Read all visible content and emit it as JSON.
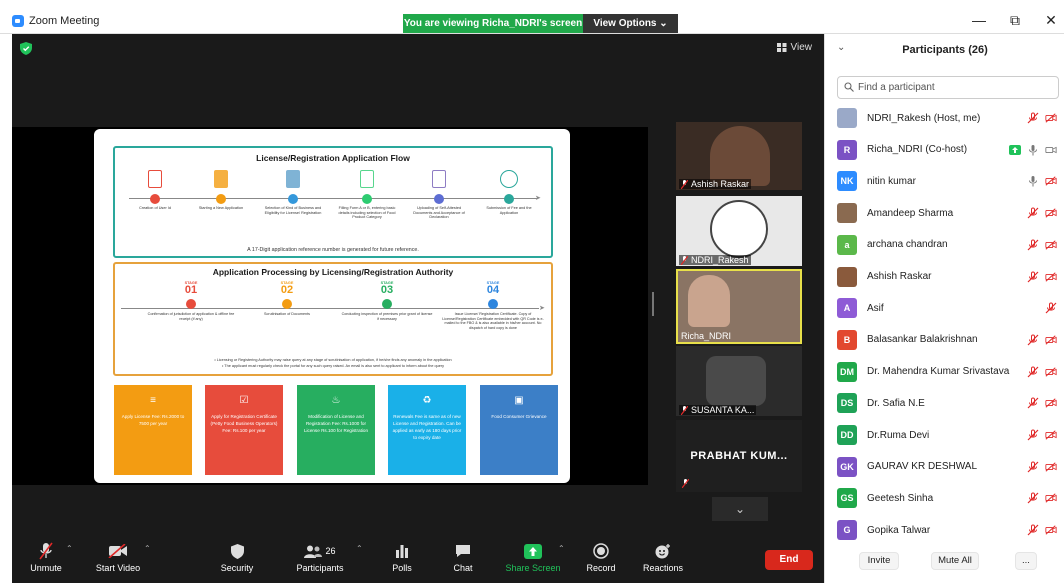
{
  "window": {
    "title": "Zoom Meeting",
    "viewing_banner": "You are viewing Richa_NDRI's screen",
    "view_options": "View Options ⌄",
    "minimize": "—",
    "restore": "⧉",
    "close": "✕"
  },
  "stage": {
    "view_label": "View"
  },
  "slide": {
    "flow_title": "License/Registration Application Flow",
    "flow_steps": [
      "Creation of User Id",
      "Starting a New Application",
      "Selection of Kind of Business and Eligibility for License/ Registration",
      "Filling Form A or B, entering basic details including selection of Food Product Category",
      "Uploading of Self-Attested Documents and Acceptance of Declaration",
      "Submission of Fee and the Application"
    ],
    "flow_note": "A 17-Digit application reference number is generated for future reference.",
    "proc_title": "Application Processing by Licensing/Registration Authority",
    "stage_word": "STAGE",
    "stages": [
      {
        "num": "01",
        "text": "Confirmation of jurisdiction of application & offline fee receipt (if any)"
      },
      {
        "num": "02",
        "text": "Scrutinisation of Documents"
      },
      {
        "num": "03",
        "text": "Conducting inspection of premises prior grant of license if necessary"
      },
      {
        "num": "04",
        "text": "Issue License/ Registration Certificate. Copy of License/Registration Certificate embedded with QR Code is e-mailed to the FBO & is also available in his/her account. No dispatch of hard copy is done"
      }
    ],
    "proc_notes": [
      "• Licensing or Registering Authority may raise query at any stage of scrutinisation of application, if he/she finds any anomaly in the application",
      "• The applicant must regularly check the portal for any such query raised. An email is also sent to applicant to inform about the query"
    ],
    "cards": [
      {
        "text": "Apply License Fee: Rs.2000 to 7500 per year",
        "color": "#f39c12",
        "icon": "≡"
      },
      {
        "text": "Apply for Registration Certificate (Petty Food Business Operators) Fee: Rs.100 per year",
        "color": "#e74c3c",
        "icon": "☑"
      },
      {
        "text": "Modification of License and Registration Fee: Rs.1000 for License Rs.100 for Registration",
        "color": "#27ae60",
        "icon": "♨"
      },
      {
        "text": "Renewals Fee is same as of new License and Registration. Can be applied as early as 180 days prior to expiry date",
        "color": "#1ab0e8",
        "icon": "♻"
      },
      {
        "text": "Food Consumer Grievance",
        "color": "#3c7fc7",
        "icon": "▣"
      }
    ]
  },
  "thumbnails": [
    {
      "name": "Ashish Raskar"
    },
    {
      "name": "NDRI_Rakesh"
    },
    {
      "name": "Richa_NDRI"
    },
    {
      "name": "SUSANTA KA..."
    },
    {
      "name": "PRABHAT KUM..."
    }
  ],
  "toolbar": {
    "unmute": "Unmute",
    "start_video": "Start Video",
    "security": "Security",
    "participants": "Participants",
    "participants_count": "26",
    "polls": "Polls",
    "chat": "Chat",
    "share_screen": "Share Screen",
    "record": "Record",
    "reactions": "Reactions",
    "end": "End"
  },
  "panel": {
    "title": "Participants (26)",
    "search_placeholder": "Find a participant",
    "invite": "Invite",
    "mute_all": "Mute All",
    "more": "...",
    "participants": [
      {
        "name": "NDRI_Rakesh (Host, me)",
        "initials": "",
        "color": "#9aa9c8",
        "audio": "muted",
        "video": "off"
      },
      {
        "name": "Richa_NDRI (Co-host)",
        "initials": "R",
        "color": "#7b52c4",
        "audio": "on",
        "video": "on-share"
      },
      {
        "name": "nitin kumar",
        "initials": "NK",
        "color": "#2d8cff",
        "audio": "on",
        "video": "off"
      },
      {
        "name": "Amandeep Sharma",
        "initials": "",
        "color": "#8a6a50",
        "audio": "muted",
        "video": "off"
      },
      {
        "name": "archana chandran",
        "initials": "a",
        "color": "#5bb84a",
        "audio": "muted",
        "video": "off"
      },
      {
        "name": "Ashish Raskar",
        "initials": "",
        "color": "#8a5a3c",
        "audio": "muted",
        "video": "off"
      },
      {
        "name": "Asif",
        "initials": "A",
        "color": "#8e5bd6",
        "audio": "muted",
        "video": "none"
      },
      {
        "name": "Balasankar Balakrishnan",
        "initials": "B",
        "color": "#e2482f",
        "audio": "muted",
        "video": "off"
      },
      {
        "name": "Dr. Mahendra Kumar Srivastava",
        "initials": "DM",
        "color": "#20a84a",
        "audio": "muted",
        "video": "off"
      },
      {
        "name": "Dr. Safia N.E",
        "initials": "DS",
        "color": "#1fa257",
        "audio": "muted",
        "video": "off"
      },
      {
        "name": "Dr.Ruma Devi",
        "initials": "DD",
        "color": "#1fa257",
        "audio": "muted",
        "video": "off"
      },
      {
        "name": "GAURAV KR DESHWAL",
        "initials": "GK",
        "color": "#7b52c4",
        "audio": "muted",
        "video": "off"
      },
      {
        "name": "Geetesh Sinha",
        "initials": "GS",
        "color": "#20a84a",
        "audio": "muted",
        "video": "off"
      },
      {
        "name": "Gopika Talwar",
        "initials": "G",
        "color": "#7b52c4",
        "audio": "muted",
        "video": "off"
      }
    ]
  }
}
